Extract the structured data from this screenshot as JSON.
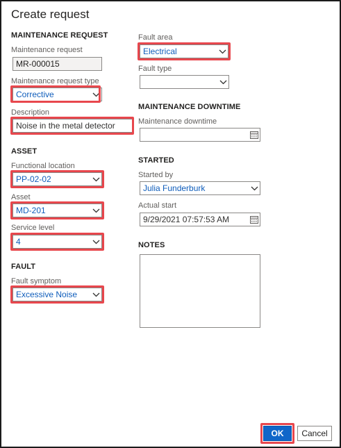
{
  "dialog": {
    "title": "Create request"
  },
  "sections": {
    "maintenance_request": "MAINTENANCE REQUEST",
    "asset": "ASSET",
    "fault": "FAULT",
    "maintenance_downtime": "MAINTENANCE DOWNTIME",
    "started": "STARTED",
    "notes": "NOTES"
  },
  "fields": {
    "maintenance_request": {
      "label": "Maintenance request",
      "value": "MR-000015"
    },
    "maintenance_request_type": {
      "label": "Maintenance request type",
      "value": "Corrective"
    },
    "description": {
      "label": "Description",
      "value": "Noise in the metal detector"
    },
    "functional_location": {
      "label": "Functional location",
      "value": "PP-02-02"
    },
    "asset": {
      "label": "Asset",
      "value": "MD-201"
    },
    "service_level": {
      "label": "Service level",
      "value": "4"
    },
    "fault_symptom": {
      "label": "Fault symptom",
      "value": "Excessive Noise"
    },
    "fault_area": {
      "label": "Fault area",
      "value": "Electrical"
    },
    "fault_type": {
      "label": "Fault type",
      "value": ""
    },
    "maintenance_downtime": {
      "label": "Maintenance downtime",
      "value": ""
    },
    "started_by": {
      "label": "Started by",
      "value": "Julia Funderburk"
    },
    "actual_start": {
      "label": "Actual start",
      "value": "9/29/2021 07:57:53 AM"
    },
    "notes": {
      "value": ""
    }
  },
  "buttons": {
    "ok": "OK",
    "cancel": "Cancel"
  },
  "icons": {
    "dropdown": "chevron-down-icon",
    "calendar": "calendar-icon"
  },
  "colors": {
    "highlight": "#e8474d",
    "primary": "#1066c9",
    "link": "#0f5dbb"
  }
}
